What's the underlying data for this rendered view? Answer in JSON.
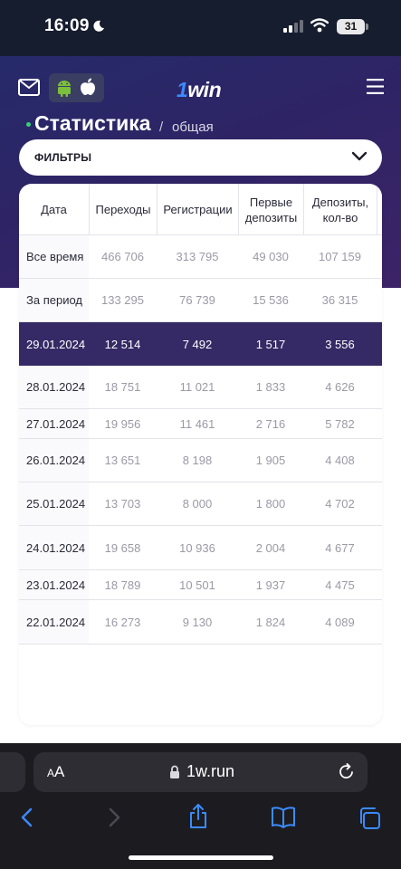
{
  "status_bar": {
    "time": "16:09",
    "battery": "31"
  },
  "header": {
    "logo_prefix": "1",
    "logo_text": "win",
    "title": "Статистика",
    "crumb_sep": "/",
    "crumb": "общая",
    "filters_label": "ФИЛЬТРЫ"
  },
  "table": {
    "columns": [
      "Дата",
      "Переходы",
      "Регистрации",
      "Первые депозиты",
      "Депозиты, кол-во"
    ],
    "rows": [
      {
        "date": "Все время",
        "values": [
          "466 706",
          "313 795",
          "49 030",
          "107 159"
        ],
        "highlight": false
      },
      {
        "date": "За период",
        "values": [
          "133 295",
          "76 739",
          "15 536",
          "36 315"
        ],
        "highlight": false
      },
      {
        "date": "29.01.2024",
        "values": [
          "12 514",
          "7 492",
          "1 517",
          "3 556"
        ],
        "highlight": true
      },
      {
        "date": "28.01.2024",
        "values": [
          "18 751",
          "11 021",
          "1 833",
          "4 626"
        ],
        "highlight": false
      },
      {
        "date": "27.01.2024",
        "values": [
          "19 956",
          "11 461",
          "2 716",
          "5 782"
        ],
        "highlight": false
      },
      {
        "date": "26.01.2024",
        "values": [
          "13 651",
          "8 198",
          "1 905",
          "4 408"
        ],
        "highlight": false
      },
      {
        "date": "25.01.2024",
        "values": [
          "13 703",
          "8 000",
          "1 800",
          "4 702"
        ],
        "highlight": false
      },
      {
        "date": "24.01.2024",
        "values": [
          "19 658",
          "10 936",
          "2 004",
          "4 677"
        ],
        "highlight": false
      },
      {
        "date": "23.01.2024",
        "values": [
          "18 789",
          "10 501",
          "1 937",
          "4 475"
        ],
        "highlight": false
      },
      {
        "date": "22.01.2024",
        "values": [
          "16 273",
          "9 130",
          "1 824",
          "4 089"
        ],
        "highlight": false
      }
    ]
  },
  "browser": {
    "aa_small": "A",
    "aa_large": "A",
    "url": "1w.run"
  },
  "colors": {
    "header_bg": "#2e2465",
    "highlight_row": "#352a66",
    "accent_green": "#33d17a",
    "logo_blue": "#3b8bff"
  }
}
